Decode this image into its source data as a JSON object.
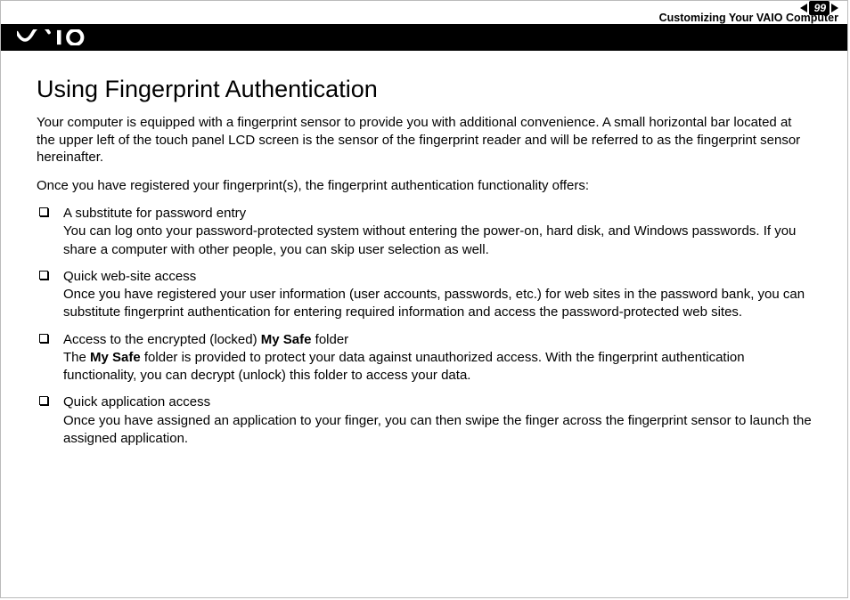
{
  "header": {
    "page_number": "99",
    "section_label": "Customizing Your VAIO Computer"
  },
  "content": {
    "title": "Using Fingerprint Authentication",
    "intro_1": "Your computer is equipped with a fingerprint sensor to provide you with additional convenience. A small horizontal bar located at the upper left of the touch panel LCD screen is the sensor of the fingerprint reader and will be referred to as the fingerprint sensor hereinafter.",
    "intro_2": "Once you have registered your fingerprint(s), the fingerprint authentication functionality offers:",
    "bullets": [
      {
        "title": "A substitute for password entry",
        "desc_pre": "You can log onto your password-protected system without entering the power-on, hard disk, and Windows passwords. If you share a computer with other people, you can skip user selection as well.",
        "bold1": "",
        "mid": "",
        "bold2": "",
        "desc_post": ""
      },
      {
        "title": "Quick web-site access",
        "desc_pre": "Once you have registered your user information (user accounts, passwords, etc.) for web sites in the password bank, you can substitute fingerprint authentication for entering required information and access the password-protected web sites.",
        "bold1": "",
        "mid": "",
        "bold2": "",
        "desc_post": ""
      },
      {
        "title_pre": "Access to the encrypted (locked) ",
        "title_bold": "My Safe",
        "title_post": " folder",
        "desc_pre": "The ",
        "bold1": "My Safe",
        "mid": " folder is provided to protect your data against unauthorized access. With the fingerprint authentication functionality, you can decrypt (unlock) this folder to access your data.",
        "bold2": "",
        "desc_post": ""
      },
      {
        "title": "Quick application access",
        "desc_pre": "Once you have assigned an application to your finger, you can then swipe the finger across the fingerprint sensor to launch the assigned application.",
        "bold1": "",
        "mid": "",
        "bold2": "",
        "desc_post": ""
      }
    ]
  }
}
